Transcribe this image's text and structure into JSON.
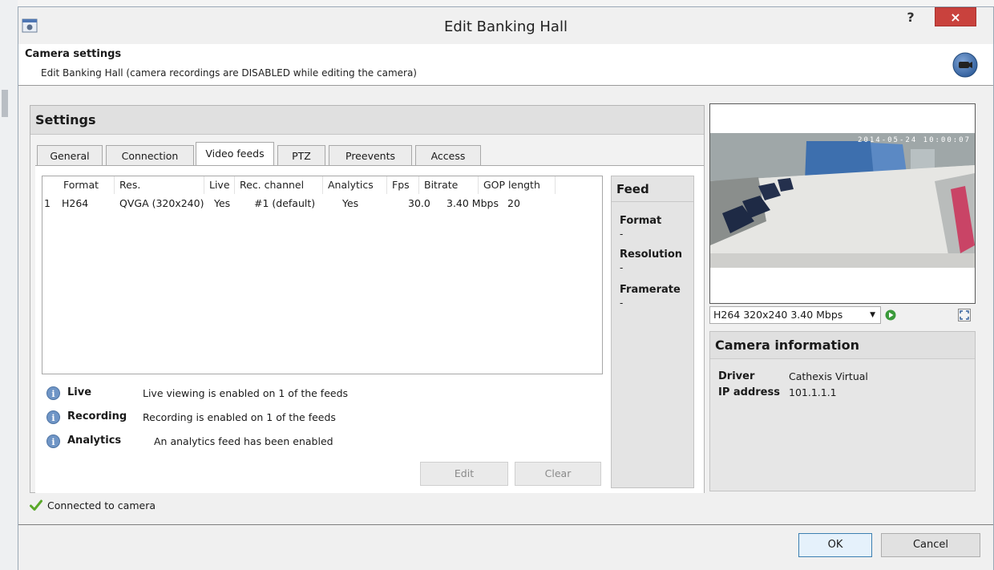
{
  "window": {
    "title": "Edit Banking Hall",
    "help_label": "?",
    "close_label": "×"
  },
  "header": {
    "title": "Camera settings",
    "subtitle": "Edit Banking Hall (camera recordings are DISABLED while editing the camera)"
  },
  "settings": {
    "title": "Settings",
    "tabs": [
      {
        "label": "General"
      },
      {
        "label": "Connection"
      },
      {
        "label": "Video feeds"
      },
      {
        "label": "PTZ"
      },
      {
        "label": "Preevents"
      },
      {
        "label": "Access"
      }
    ],
    "active_tab": "Video feeds"
  },
  "table": {
    "columns": [
      "Format",
      "Res.",
      "Live",
      "Rec. channel",
      "Analytics",
      "Fps",
      "Bitrate",
      "GOP length"
    ],
    "rows": [
      {
        "index": "1",
        "format": "H264",
        "res": "QVGA (320x240)",
        "live": "Yes",
        "rec_channel": "#1 (default)",
        "analytics": "Yes",
        "fps": "30.0",
        "bitrate": "3.40 Mbps",
        "gop": "20"
      }
    ]
  },
  "info": [
    {
      "name": "Live",
      "text": "Live viewing is enabled on 1 of the feeds"
    },
    {
      "name": "Recording",
      "text": "Recording is enabled on 1 of the feeds"
    },
    {
      "name": "Analytics",
      "text": "An analytics feed has been enabled"
    }
  ],
  "buttons": {
    "edit": "Edit",
    "clear": "Clear",
    "ok": "OK",
    "cancel": "Cancel"
  },
  "feed_panel": {
    "title": "Feed",
    "fields": [
      {
        "label": "Format",
        "value": "-"
      },
      {
        "label": "Resolution",
        "value": "-"
      },
      {
        "label": "Framerate",
        "value": "-"
      }
    ]
  },
  "preview": {
    "timestamp": "2014-05-24 10:00:07",
    "feed_select_value": "H264 320x240 3.40 Mbps"
  },
  "camera_info": {
    "title": "Camera information",
    "driver_label": "Driver",
    "driver_value": "Cathexis Virtual",
    "ip_label": "IP address",
    "ip_value": "101.1.1.1"
  },
  "status": {
    "text": "Connected to camera"
  },
  "colors": {
    "close_red": "#c9423d",
    "info_blue": "#6f95c6",
    "status_green": "#5aa829",
    "play_green": "#3a9a3a"
  }
}
